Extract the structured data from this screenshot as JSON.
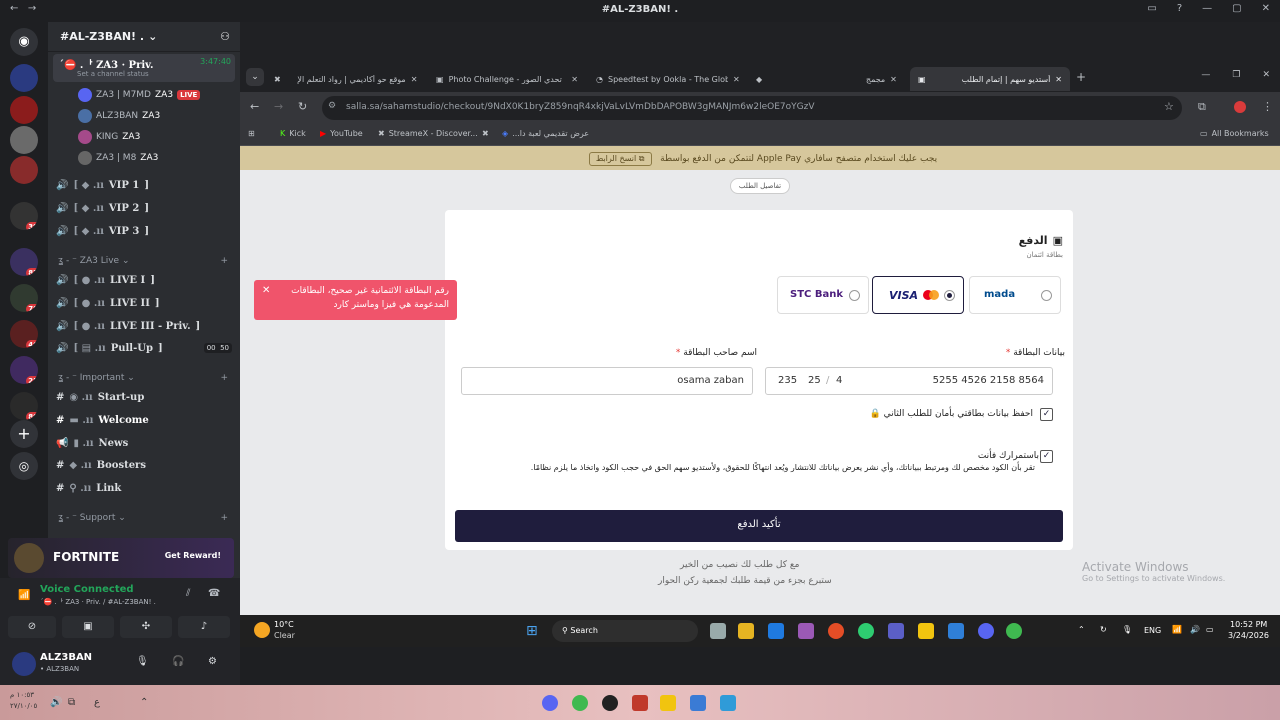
{
  "titlebar": {
    "title": "#AL-Z3BAN! ."
  },
  "server": {
    "name": "#AL-Z3BAN! .",
    "badges": [
      "39",
      "82",
      "78",
      "46",
      "25",
      "80"
    ]
  },
  "channels": {
    "active_voice": {
      "name": "´⛔ .ᅡ ZA3 · Priv.",
      "timer": "3:47:40",
      "status": "Set a channel status"
    },
    "members": [
      {
        "name": "ZA3 | M7MD",
        "tag": "ZA3",
        "live": "LIVE"
      },
      {
        "name": "ALZ3BAN",
        "tag": "ZA3"
      },
      {
        "name": "KING",
        "tag": "ZA3"
      },
      {
        "name": "ZA3 | M8",
        "tag": "ZA3"
      }
    ],
    "vip": [
      "VIP 1",
      "VIP 2",
      "VIP 3"
    ],
    "cat_live": "ZA3 Live",
    "live": [
      "LIVE I",
      "LIVE II",
      "LIVE III - Priv."
    ],
    "pullup": {
      "name": "Pull-Up",
      "c1": "00",
      "c2": "50"
    },
    "cat_important": "Important",
    "important": [
      "Start-up",
      "Welcome",
      "News",
      "Boosters",
      "Link"
    ],
    "cat_support": "Support"
  },
  "banner": {
    "title": "FORTNITE",
    "cta": "Get Reward!"
  },
  "voice": {
    "status": "Voice Connected",
    "channel": "´⛔ .ᅡ ZA3 · Priv. ∕ #AL-Z3BAN! ."
  },
  "user": {
    "name": "ALZ3BAN",
    "sub": "• ALZ3BAN"
  },
  "browser": {
    "tabs": [
      "موقع حو أكاديمي | رواد التعلم الإ",
      "Photo Challenge - تحدي الصور",
      "Speedtest by Ookla - The Globa",
      "مجمج",
      "أستديو سهم | إتمام الطلب"
    ],
    "url": "salla.sa/sahamstudio/checkout/9NdX0K1bryZ859nqR4xkjVaLvLVmDbDAPOBW3gMANJm6w2leOE7oYGzV",
    "bookmarks": [
      "Kick",
      "YouTube",
      "StreameX - Discover...",
      "عرض تقديمي لعبة دا..."
    ],
    "all_bookmarks": "All Bookmarks"
  },
  "checkout": {
    "applepay": "لتتمكن من الدفع بواسطة Apple Pay يجب عليك استخدام متصفح سافاري",
    "copy_link": "انسخ الرابط",
    "order_details": "تفاصيل الطلب",
    "payment_title": "الدفع",
    "payment_sub": "بطاقة ائتمان",
    "methods": [
      "mada",
      "VISA",
      "STC Bank"
    ],
    "card_label": "بيانات البطاقة",
    "holder_label": "اسم صاحب البطاقة",
    "card_number": "5255 4526 2158 8564",
    "expiry_month": "4",
    "expiry_year": "25",
    "cvv": "235",
    "holder": "osama zaban",
    "save_label": "احفظ بيانات بطاقتي بأمان للطلب الثاني",
    "agree_title": "باستمرارك فأنت",
    "agree_text": "تقر بأن الكود مخصص لك ومرتبط ببياناتك، وأي نشر يعرض بياناتك للانتشار ويُعد انتهاكًا للحقوق، ولأستديو سهم الحق في حجب الكود واتخاذ ما يلزم نظامًا.",
    "confirm": "تأكيد الدفع",
    "footer1": "مع كل طلب لك نصيب من الخير",
    "footer2": "ستبرع بجزء من قيمة طلبك لجمعية ركن الحوار",
    "toast": "رقم البطاقة الائتمانية غير صحيح، البطاقات المدعومة هي فيزا وماستر كارد"
  },
  "activate": {
    "title": "Activate Windows",
    "sub": "Go to Settings to activate Windows."
  },
  "taskbar": {
    "temp": "10°C",
    "weather": "Clear",
    "search": "Search",
    "lang": "ENG",
    "time": "10:52 PM",
    "date": "3/24/2026"
  },
  "bottom": {
    "time": "١٠:٥٣ م",
    "date": "٢٧/١٠/٠٥"
  }
}
